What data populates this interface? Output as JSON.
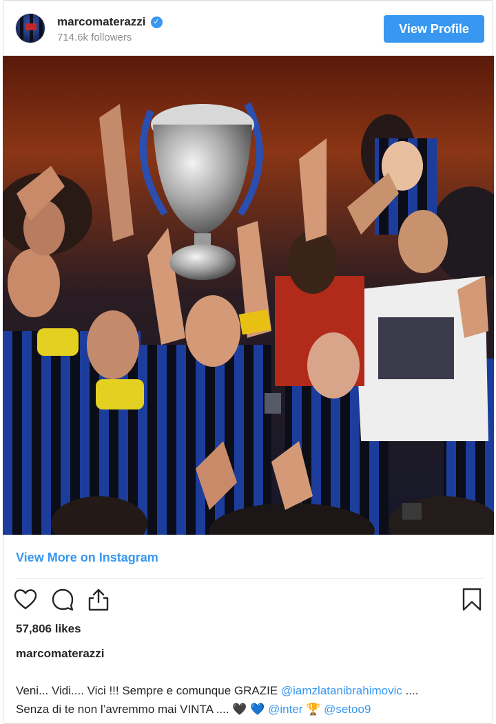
{
  "header": {
    "username": "marcomaterazzi",
    "followers": "714.6k followers",
    "view_profile_label": "View Profile",
    "verified_icon": "verified-check-icon"
  },
  "post": {
    "image_icon": "photo",
    "view_more_label": "View More on Instagram",
    "likes": "57,806 likes",
    "caption_user": "marcomaterazzi",
    "caption_text_1": "Veni... Vidi.... Vici !!! Sempre e comunque GRAZIE ",
    "caption_mention_1": "@iamzlatanibrahimovic",
    "caption_text_2": " ....",
    "caption_text_3": "Senza di te non l’avremmo mai VINTA .... ",
    "caption_emoji_1": "🖤",
    "caption_emoji_2": "💙",
    "caption_mention_2": "@inter",
    "caption_emoji_3": "🏆",
    "caption_mention_3": "@setoo9"
  },
  "colors": {
    "accent": "#3897f0",
    "text": "#262626",
    "muted": "#8e8e8e"
  }
}
